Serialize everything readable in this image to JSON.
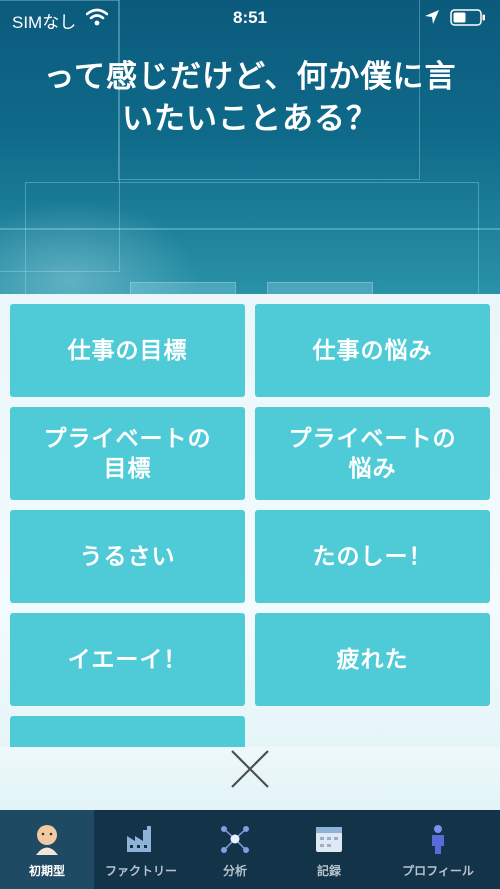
{
  "status_bar": {
    "carrier": "SIMなし",
    "time": "8:51"
  },
  "question": {
    "line1": "って感じだけど、何か僕に言",
    "line2": "いたいことある？"
  },
  "options": [
    "仕事の目標",
    "仕事の悩み",
    "プライベートの\n目標",
    "プライベートの\n悩み",
    "うるさい",
    "たのしー！",
    "イエーイ！",
    "疲れた",
    ""
  ],
  "tabs": [
    {
      "label": "初期型",
      "icon": "character-icon",
      "active": true
    },
    {
      "label": "ファクトリー",
      "icon": "factory-icon"
    },
    {
      "label": "分析",
      "icon": "network-icon"
    },
    {
      "label": "記録",
      "icon": "calendar-icon"
    },
    {
      "label": "プロフィール",
      "icon": "person-icon"
    }
  ],
  "colors": {
    "option": "#4ecbd6",
    "tabbar": "#123348",
    "tab_active": "#1f4a63"
  }
}
